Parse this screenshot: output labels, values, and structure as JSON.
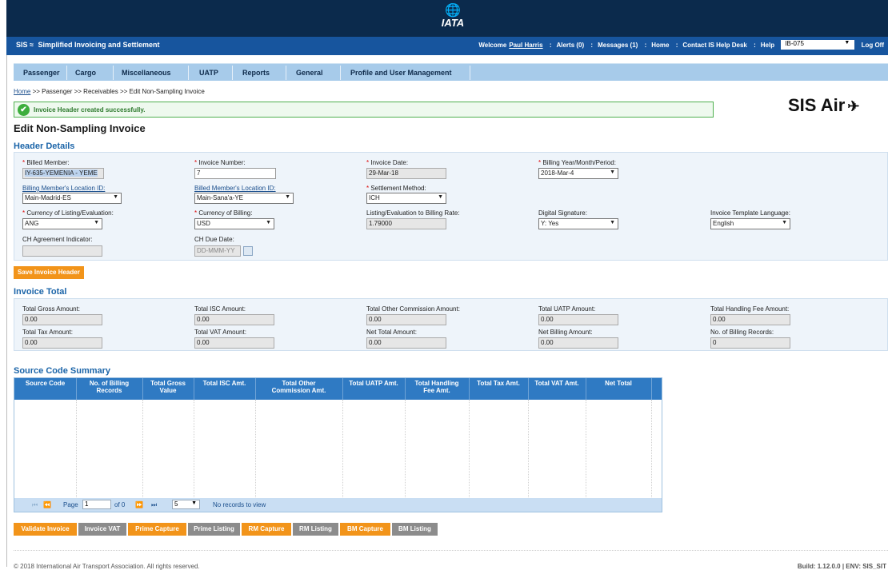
{
  "header": {
    "logo_text": "IATA",
    "app_name": "Simplified Invoicing and Settlement",
    "app_abbr": "SIS",
    "welcome": "Welcome",
    "user": "Paul Harris",
    "alerts": "Alerts (0)",
    "messages": "Messages (1)",
    "home": "Home",
    "contact": "Contact IS Help Desk",
    "help": "Help",
    "member": "IB-075",
    "logoff": "Log Off"
  },
  "nav": [
    "Passenger",
    "Cargo",
    "Miscellaneous",
    "UATP",
    "Reports",
    "General",
    "Profile and User Management"
  ],
  "breadcrumb": {
    "home": "Home",
    "rest": " >> Passenger >> Receivables >> Edit Non-Sampling Invoice"
  },
  "success_message": "Invoice Header created successfully.",
  "brand_right": "SIS Air",
  "page_title": "Edit Non-Sampling Invoice",
  "header_details": {
    "title": "Header Details",
    "billed_member": {
      "label": "Billed Member:",
      "value": "IY-635-YEMENIA - YEME"
    },
    "invoice_number": {
      "label": "Invoice Number:",
      "value": "7"
    },
    "invoice_date": {
      "label": "Invoice Date:",
      "value": "29-Mar-18"
    },
    "billing_period": {
      "label": "Billing Year/Month/Period:",
      "value": "2018-Mar-4"
    },
    "billing_location": {
      "label": "Billing Member's Location ID:",
      "value": "Main-Madrid-ES"
    },
    "billed_location": {
      "label": "Billed Member's Location ID:",
      "value": "Main-Sana'a-YE"
    },
    "settlement_method": {
      "label": "Settlement Method:",
      "value": "ICH"
    },
    "currency_listing": {
      "label": "Currency of Listing/Evaluation:",
      "value": "ANG"
    },
    "currency_billing": {
      "label": "Currency of Billing:",
      "value": "USD"
    },
    "rate": {
      "label": "Listing/Evaluation to Billing Rate:",
      "value": "1.79000"
    },
    "digital_signature": {
      "label": "Digital Signature:",
      "value": "Y: Yes"
    },
    "template_language": {
      "label": "Invoice Template Language:",
      "value": "English"
    },
    "ch_agreement": {
      "label": "CH Agreement Indicator:",
      "value": ""
    },
    "ch_due_date": {
      "label": "CH Due Date:",
      "placeholder": "DD-MMM-YY"
    },
    "save_button": "Save Invoice Header"
  },
  "invoice_total": {
    "title": "Invoice Total",
    "fields": [
      {
        "label": "Total Gross Amount:",
        "value": "0.00"
      },
      {
        "label": "Total ISC Amount:",
        "value": "0.00"
      },
      {
        "label": "Total Other Commission Amount:",
        "value": "0.00"
      },
      {
        "label": "Total UATP Amount:",
        "value": "0.00"
      },
      {
        "label": "Total Handling Fee Amount:",
        "value": "0.00"
      },
      {
        "label": "Total Tax Amount:",
        "value": "0.00"
      },
      {
        "label": "Total VAT Amount:",
        "value": "0.00"
      },
      {
        "label": "Net Total Amount:",
        "value": "0.00"
      },
      {
        "label": "Net Billing Amount:",
        "value": "0.00"
      },
      {
        "label": "No. of Billing Records:",
        "value": "0"
      }
    ]
  },
  "source_code_summary": {
    "title": "Source Code Summary",
    "columns": [
      [
        "Source Code",
        ""
      ],
      [
        "No. of Billing",
        "Records"
      ],
      [
        "Total Gross",
        "Value"
      ],
      [
        "Total ISC Amt.",
        ""
      ],
      [
        "Total Other",
        "Commission Amt."
      ],
      [
        "Total UATP Amt.",
        ""
      ],
      [
        "Total Handling",
        "Fee Amt."
      ],
      [
        "Total Tax Amt.",
        ""
      ],
      [
        "Total VAT Amt.",
        ""
      ],
      [
        "Net Total",
        ""
      ]
    ],
    "pager": {
      "page_label": "Page",
      "page": "1",
      "of": "of 0",
      "page_size": "5",
      "empty": "No records to view"
    }
  },
  "actions": [
    "Validate Invoice",
    "Invoice VAT",
    "Prime Capture",
    "Prime Listing",
    "RM Capture",
    "RM Listing",
    "BM Capture",
    "BM Listing"
  ],
  "footer": {
    "copyright": "© 2018 International Air Transport Association. All rights reserved.",
    "build": "Build: 1.12.0.0 | ENV: SIS_SIT"
  }
}
